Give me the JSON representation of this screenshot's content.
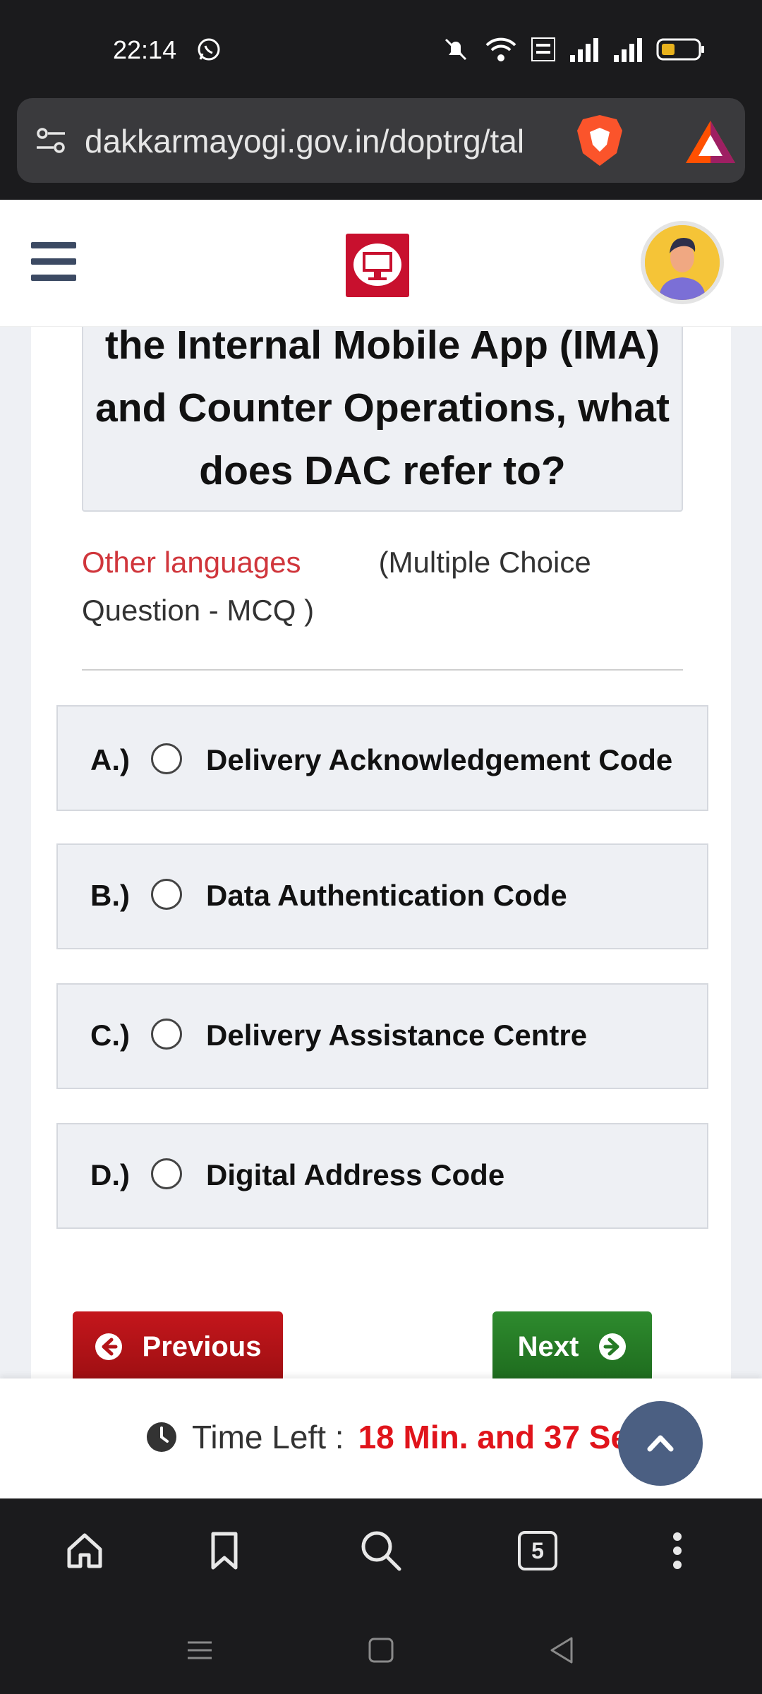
{
  "status": {
    "time": "22:14"
  },
  "browser": {
    "url": "dakkarmayogi.gov.in/doptrg/tal",
    "tab_count": "5"
  },
  "question": {
    "text": "the Internal Mobile App (IMA) and Counter Operations, what does DAC refer to?",
    "other_languages": "Other languages",
    "type": "(Multiple Choice Question - MCQ )"
  },
  "options": [
    {
      "letter": "A.)",
      "text": "Delivery Acknowledgement Code"
    },
    {
      "letter": "B.)",
      "text": "Data Authentication Code"
    },
    {
      "letter": "C.)",
      "text": "Delivery Assistance Centre"
    },
    {
      "letter": "D.)",
      "text": "Digital Address Code"
    }
  ],
  "buttons": {
    "previous": "Previous",
    "next": "Next"
  },
  "timer": {
    "label": "Time Left :",
    "value": "18 Min. and 37 Sec."
  },
  "colors": {
    "accent_red": "#c4161c",
    "accent_green": "#2e8b2e",
    "timer_red": "#e0141b",
    "nav_blue": "#4b5f82"
  }
}
